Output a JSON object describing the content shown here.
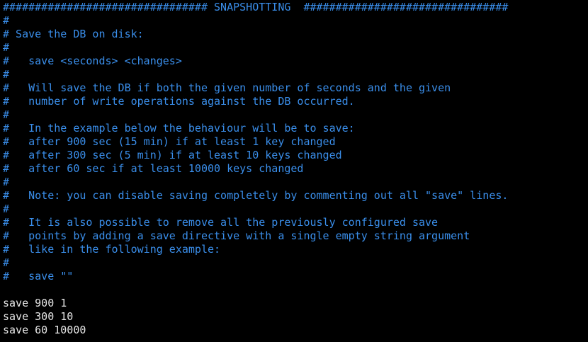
{
  "colors": {
    "background": "#000000",
    "comment": "#3a8eea",
    "code": "#e6e6e6"
  },
  "lines": [
    {
      "type": "comment",
      "text": "################################ SNAPSHOTTING  ################################"
    },
    {
      "type": "comment",
      "text": "#"
    },
    {
      "type": "comment",
      "text": "# Save the DB on disk:"
    },
    {
      "type": "comment",
      "text": "#"
    },
    {
      "type": "comment",
      "text": "#   save <seconds> <changes>"
    },
    {
      "type": "comment",
      "text": "#"
    },
    {
      "type": "comment",
      "text": "#   Will save the DB if both the given number of seconds and the given"
    },
    {
      "type": "comment",
      "text": "#   number of write operations against the DB occurred."
    },
    {
      "type": "comment",
      "text": "#"
    },
    {
      "type": "comment",
      "text": "#   In the example below the behaviour will be to save:"
    },
    {
      "type": "comment",
      "text": "#   after 900 sec (15 min) if at least 1 key changed"
    },
    {
      "type": "comment",
      "text": "#   after 300 sec (5 min) if at least 10 keys changed"
    },
    {
      "type": "comment",
      "text": "#   after 60 sec if at least 10000 keys changed"
    },
    {
      "type": "comment",
      "text": "#"
    },
    {
      "type": "comment",
      "text": "#   Note: you can disable saving completely by commenting out all \"save\" lines."
    },
    {
      "type": "comment",
      "text": "#"
    },
    {
      "type": "comment",
      "text": "#   It is also possible to remove all the previously configured save"
    },
    {
      "type": "comment",
      "text": "#   points by adding a save directive with a single empty string argument"
    },
    {
      "type": "comment",
      "text": "#   like in the following example:"
    },
    {
      "type": "comment",
      "text": "#"
    },
    {
      "type": "comment",
      "text": "#   save \"\""
    },
    {
      "type": "blank",
      "text": ""
    },
    {
      "type": "code",
      "text": "save 900 1"
    },
    {
      "type": "code",
      "text": "save 300 10"
    },
    {
      "type": "code",
      "text": "save 60 10000"
    }
  ]
}
